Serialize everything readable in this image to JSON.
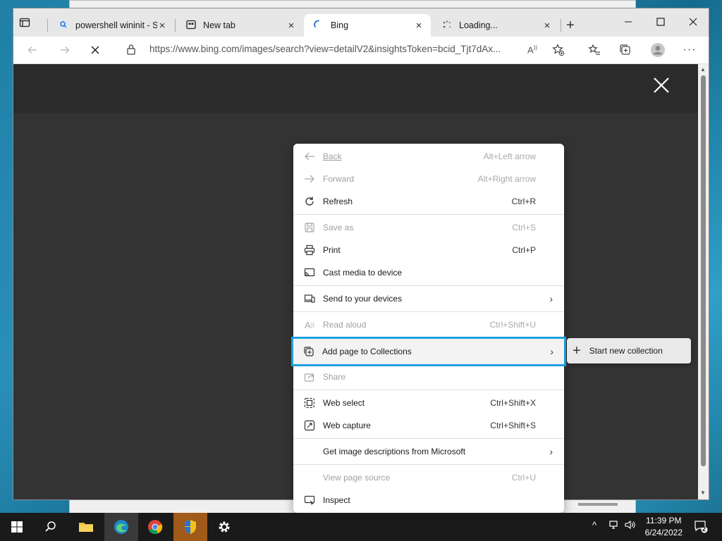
{
  "tabs": [
    {
      "label": "powershell wininit - S",
      "icon": "search-icon"
    },
    {
      "label": "New tab",
      "icon": "newtab-icon"
    },
    {
      "label": "Bing",
      "icon": "loading-icon"
    },
    {
      "label": "Loading...",
      "icon": "loading-icon"
    }
  ],
  "address_bar": {
    "url": "https://www.bing.com/images/search?view=detailV2&insightsToken=bcid_Tjt7dAx..."
  },
  "context_menu": {
    "items": [
      {
        "label": "Back",
        "shortcut": "Alt+Left arrow",
        "enabled": false,
        "icon": "back-arrow-icon"
      },
      {
        "label": "Forward",
        "shortcut": "Alt+Right arrow",
        "enabled": false,
        "icon": "forward-arrow-icon"
      },
      {
        "label": "Refresh",
        "shortcut": "Ctrl+R",
        "enabled": true,
        "icon": "refresh-icon"
      },
      {
        "label": "Save as",
        "shortcut": "Ctrl+S",
        "enabled": false,
        "icon": "save-icon"
      },
      {
        "label": "Print",
        "shortcut": "Ctrl+P",
        "enabled": true,
        "icon": "print-icon"
      },
      {
        "label": "Cast media to device",
        "shortcut": "",
        "enabled": true,
        "icon": "cast-icon"
      },
      {
        "label": "Send to your devices",
        "shortcut": "",
        "enabled": true,
        "icon": "devices-icon",
        "submenu": true
      },
      {
        "label": "Read aloud",
        "shortcut": "Ctrl+Shift+U",
        "enabled": false,
        "icon": "read-aloud-icon"
      },
      {
        "label": "Add page to Collections",
        "shortcut": "",
        "enabled": true,
        "icon": "collections-icon",
        "submenu": true,
        "highlighted": true
      },
      {
        "label": "Share",
        "shortcut": "",
        "enabled": false,
        "icon": "share-icon"
      },
      {
        "label": "Web select",
        "shortcut": "Ctrl+Shift+X",
        "enabled": true,
        "icon": "web-select-icon"
      },
      {
        "label": "Web capture",
        "shortcut": "Ctrl+Shift+S",
        "enabled": true,
        "icon": "web-capture-icon"
      },
      {
        "label": "Get image descriptions from Microsoft",
        "shortcut": "",
        "enabled": true,
        "icon": "",
        "submenu": true
      },
      {
        "label": "View page source",
        "shortcut": "Ctrl+U",
        "enabled": false,
        "icon": ""
      },
      {
        "label": "Inspect",
        "shortcut": "",
        "enabled": true,
        "icon": "inspect-icon"
      }
    ]
  },
  "submenu": {
    "label": "Start new collection"
  },
  "taskbar": {
    "time": "11:39 PM",
    "date": "6/24/2022",
    "notifications": "2"
  },
  "colors": {
    "highlight_outline": "#1ba1e2",
    "viewport_bg": "#333333"
  }
}
